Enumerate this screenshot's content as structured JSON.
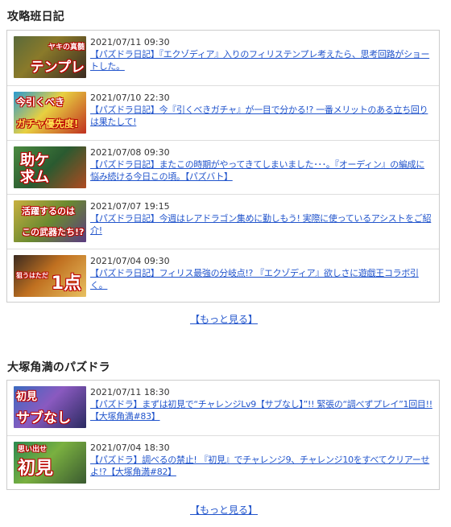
{
  "sections": [
    {
      "title": "攻略班日記",
      "more_label": "【もっと見る】",
      "articles": [
        {
          "date": "2021/07/11 09:30",
          "title": "【パズドラ日記】『エクゾディア』入りのフィリステンプレ考えたら、思考回路がショートした。",
          "thumb_caption": "テンプレ",
          "thumb_caption2": "ヤキの真髄"
        },
        {
          "date": "2021/07/10 22:30",
          "title": "【パズドラ日記】今『引くべきガチャ』が一目で分かる!? 一番メリットのある立ち回りは果たして!",
          "thumb_caption": "ガチャ優先度!",
          "thumb_caption2": "今引くべき"
        },
        {
          "date": "2021/07/08 09:30",
          "title": "【パズドラ日記】またこの時期がやってきてしまいました･･･。『オーディン』の編成に悩み続ける今日この頃。【パズバト】",
          "thumb_caption": "助ケ",
          "thumb_caption2": "求ム"
        },
        {
          "date": "2021/07/07 19:15",
          "title": "【パズドラ日記】今週はレアドラゴン集めに勤しもう! 実際に使っているアシストをご紹介!",
          "thumb_caption": "活躍するのは",
          "thumb_caption2": "この武器たち!?"
        },
        {
          "date": "2021/07/04 09:30",
          "title": "【パズドラ日記】フィリス最強の分岐点!? 『エクゾディア』欲しさに遊戯王コラボ引く。",
          "thumb_caption": "1点",
          "thumb_caption2": "狙うはただ"
        }
      ]
    },
    {
      "title": "大塚角満のパズドラ",
      "more_label": "【もっと見る】",
      "articles": [
        {
          "date": "2021/07/11 18:30",
          "title": "【パズドラ】まずは初見で“チャレンジLv9【サブなし】”!! 緊張の“調べずプレイ”1回目!!【大塚角満#83】",
          "thumb_caption": "サブなし",
          "thumb_caption2": "初見"
        },
        {
          "date": "2021/07/04 18:30",
          "title": "【パズドラ】調べるの禁止! 『初見』でチャレンジ9、チャレンジ10をすべてクリアーせよ!?【大塚角満#82】",
          "thumb_caption": "初見",
          "thumb_caption2": "思い出せ"
        }
      ]
    }
  ]
}
